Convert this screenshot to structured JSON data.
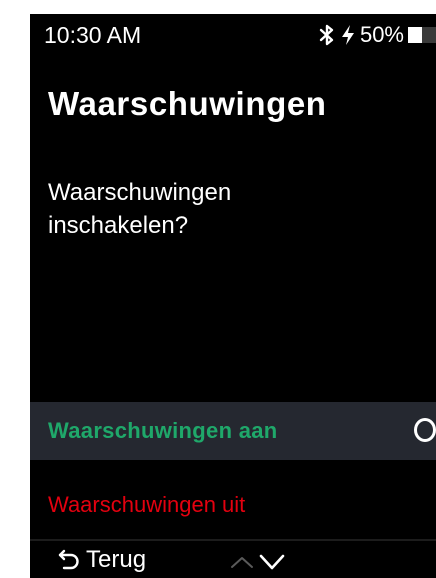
{
  "status_bar": {
    "time": "10:30 AM",
    "battery_percent_label": "50%",
    "battery_level": 0.5,
    "icons": [
      "bluetooth-icon",
      "charging-bolt-icon",
      "battery-icon"
    ]
  },
  "page": {
    "title": "Waarschuwingen",
    "question": "Waarschuwingen inschakelen?"
  },
  "options": [
    {
      "label": "Waarschuwingen aan",
      "selected": true,
      "color": "#1fa86a"
    },
    {
      "label": "Waarschuwingen uit",
      "selected": false,
      "color": "#e3000f"
    }
  ],
  "bottom_bar": {
    "back_label": "Terug",
    "icons": [
      "back-arrow-icon",
      "scroll-up-icon",
      "scroll-down-icon"
    ]
  },
  "colors": {
    "background": "#000000",
    "highlight_row": "#252830",
    "accent_green": "#1fa86a",
    "accent_red": "#e3000f"
  }
}
